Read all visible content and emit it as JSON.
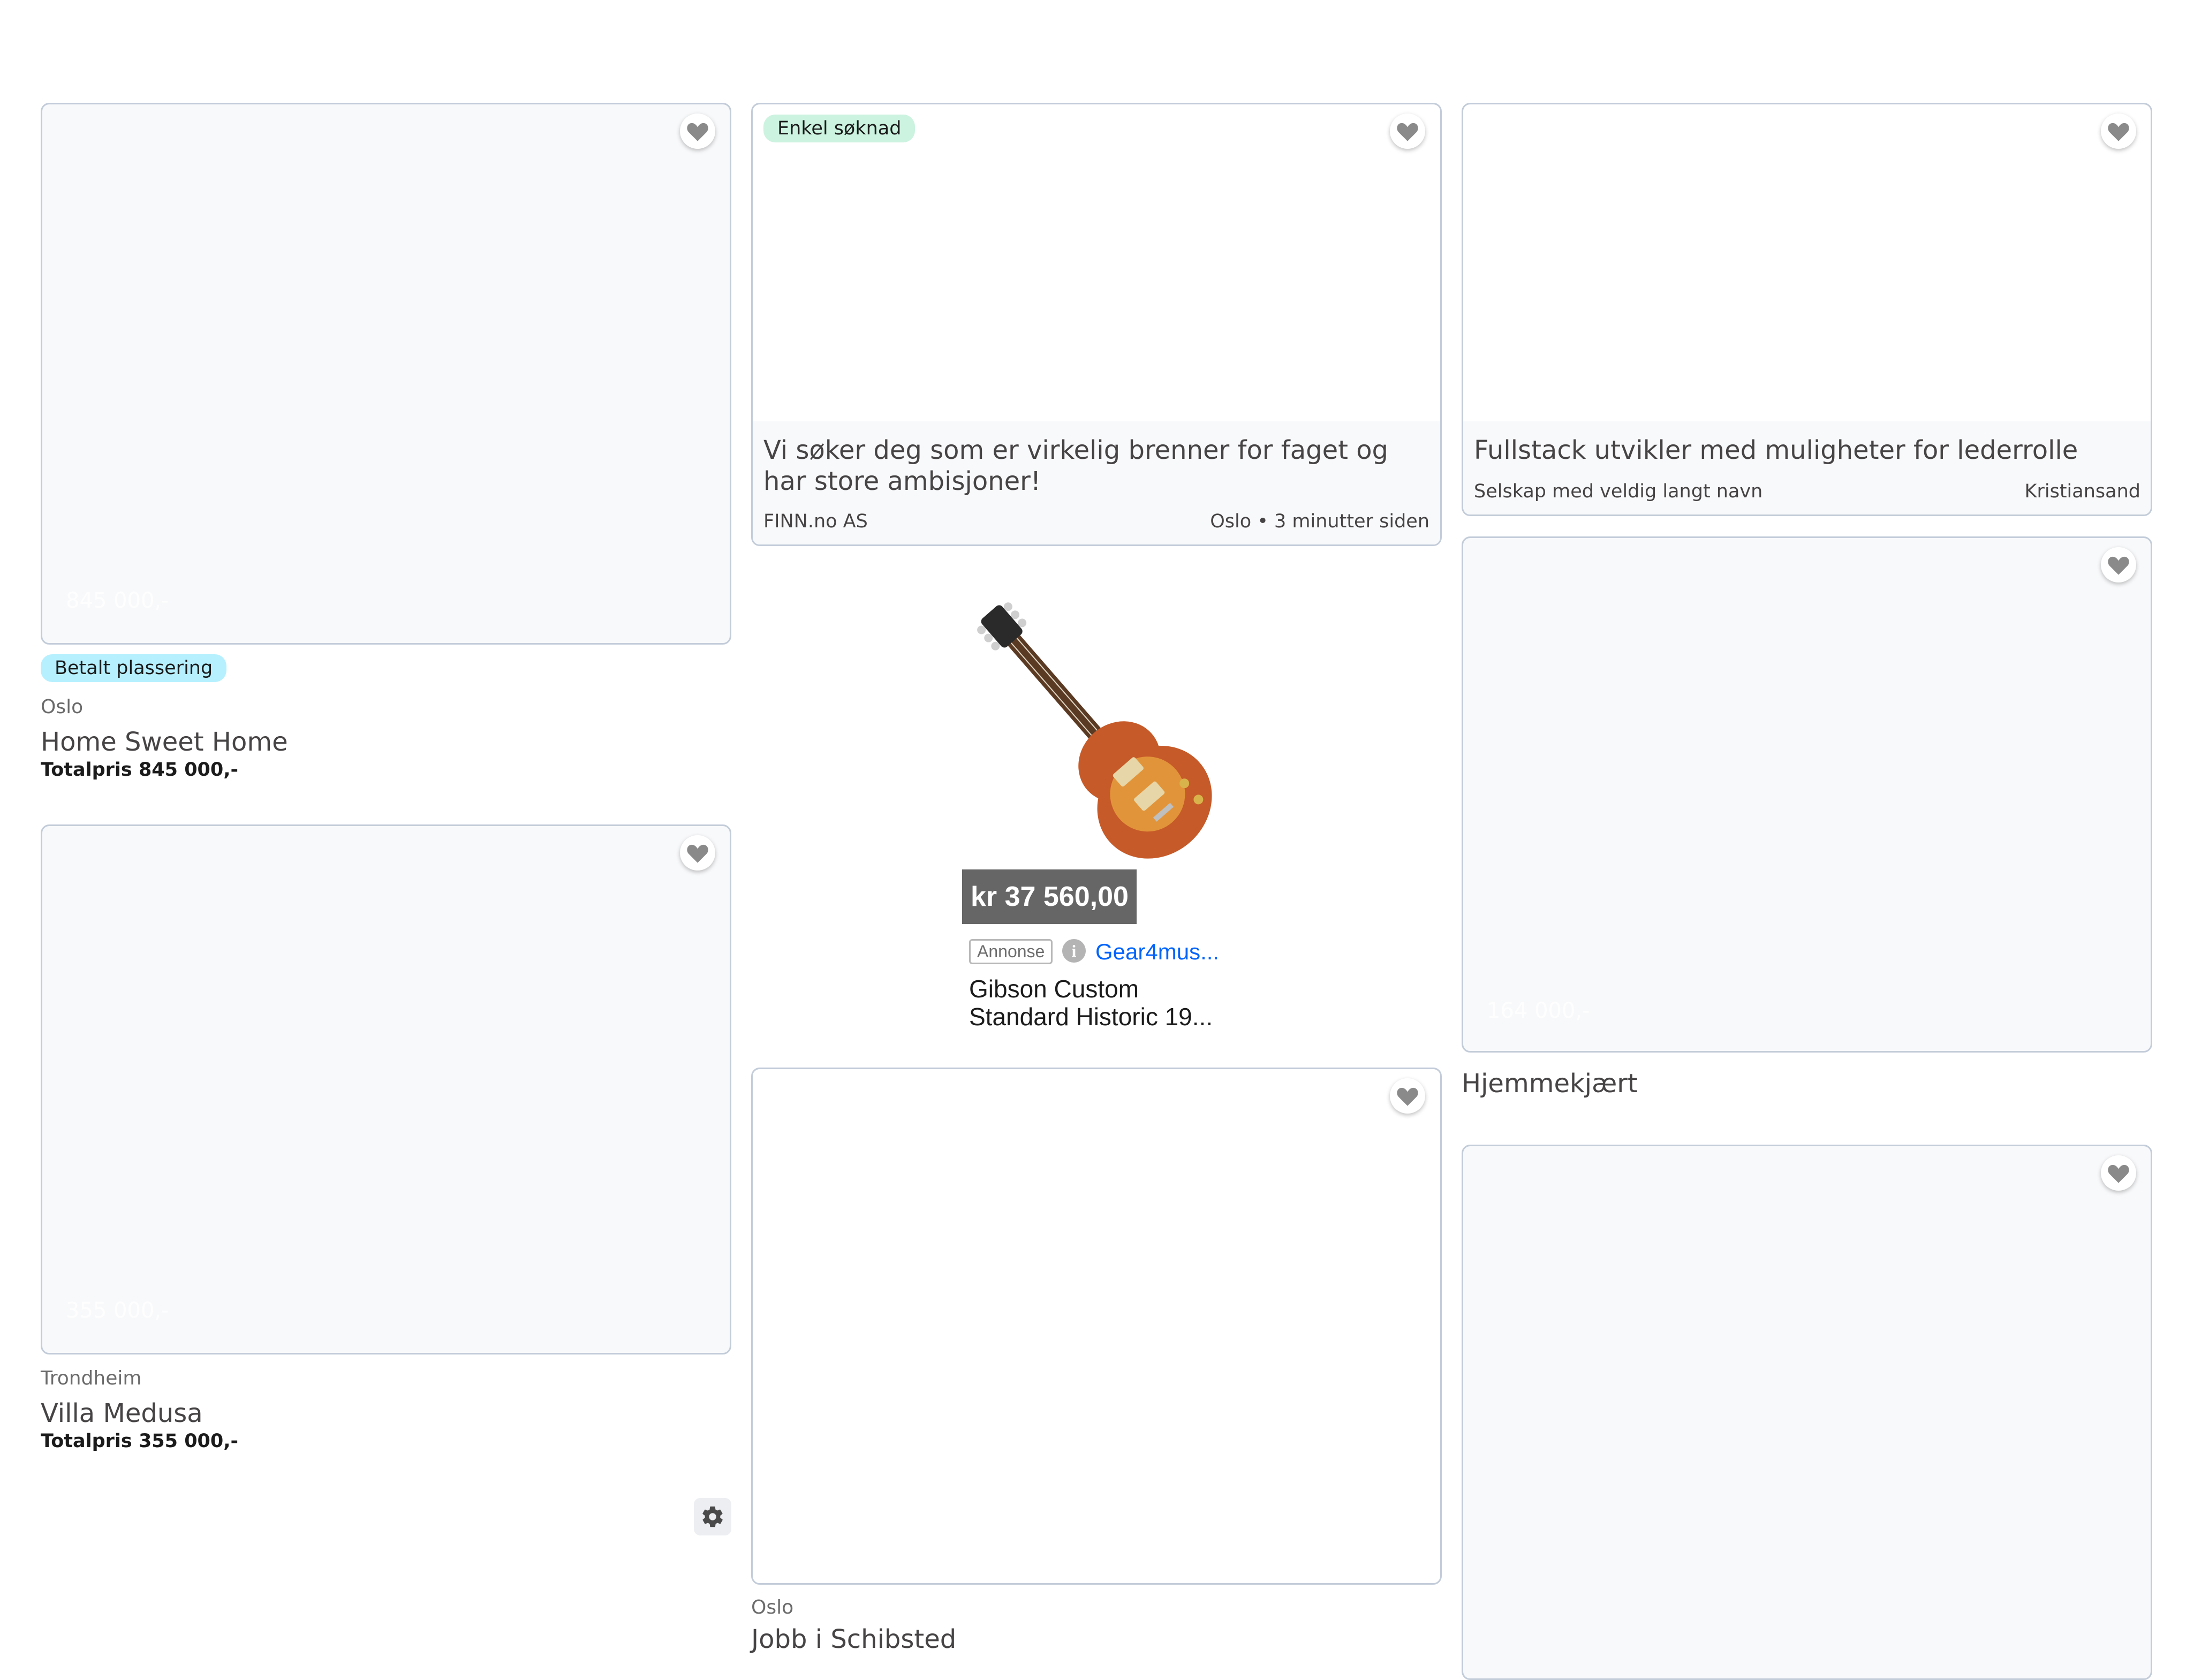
{
  "card1": {
    "price_overlay": "845 000,-",
    "badge": "Betalt plassering",
    "location": "Oslo",
    "title": "Home Sweet Home",
    "total": "Totalpris 845 000,-"
  },
  "card2": {
    "price_overlay": "355 000,-",
    "location": "Trondheim",
    "title": "Villa Medusa",
    "total": "Totalpris 355 000,-"
  },
  "job1": {
    "badge": "Enkel søknad",
    "title": "Vi søker deg som er virkelig brenner for faget og har store ambisjoner!",
    "company": "FINN.no AS",
    "meta": "Oslo • 3 minutter siden"
  },
  "job2": {
    "title": "Fullstack utvikler med muligheter for lederrolle",
    "company": "Selskap med veldig langt navn",
    "location": "Kristiansand"
  },
  "ad": {
    "price": "kr 37 560,00",
    "label": "Annonse",
    "info_icon": "info-icon",
    "advertiser": "Gear4mus...",
    "title_line1": "Gibson Custom",
    "title_line2": "Standard Historic 19..."
  },
  "card3": {
    "price_overlay": "164 000,-",
    "title": "Hjemmekjært"
  },
  "card5": {
    "location": "Oslo",
    "title": "Jobb i Schibsted"
  },
  "icons": {
    "favorite": "heart-icon",
    "settings": "gear-icon"
  },
  "colors": {
    "card_border": "#c3ccd9",
    "card_bg": "#f8f9fb",
    "paid_badge": "#b6f0ff",
    "easy_badge": "#ccf3e0",
    "ad_price_bg": "#666666",
    "ad_link": "#0063fb"
  }
}
